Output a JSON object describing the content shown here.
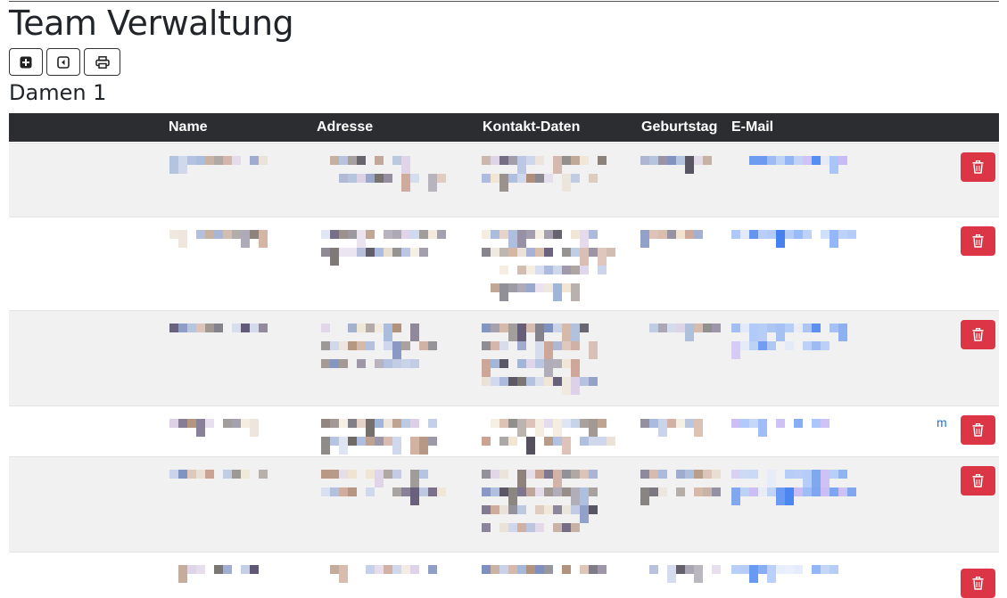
{
  "page": {
    "title": "Team Verwaltung"
  },
  "toolbar": {
    "buttons": [
      {
        "icon": "plus-square-icon"
      },
      {
        "icon": "caret-left-square-icon"
      },
      {
        "icon": "printer-icon"
      }
    ]
  },
  "team": {
    "name": "Damen 1"
  },
  "table": {
    "headers": {
      "name": "Name",
      "address": "Adresse",
      "contact": "Kontakt-Daten",
      "birthday": "Geburtstag",
      "email": "E-Mail"
    },
    "rows": [
      {
        "status": "redacted"
      },
      {
        "status": "redacted"
      },
      {
        "status": "redacted"
      },
      {
        "status": "redacted",
        "email_visible_tail": "m"
      },
      {
        "status": "redacted"
      },
      {
        "status": "redacted"
      }
    ]
  },
  "colors": {
    "header_bg": "#2b2d30",
    "delete": "#dc3545",
    "stripe": "#f1f1f1"
  },
  "icons": {
    "delete": "trash-icon"
  }
}
